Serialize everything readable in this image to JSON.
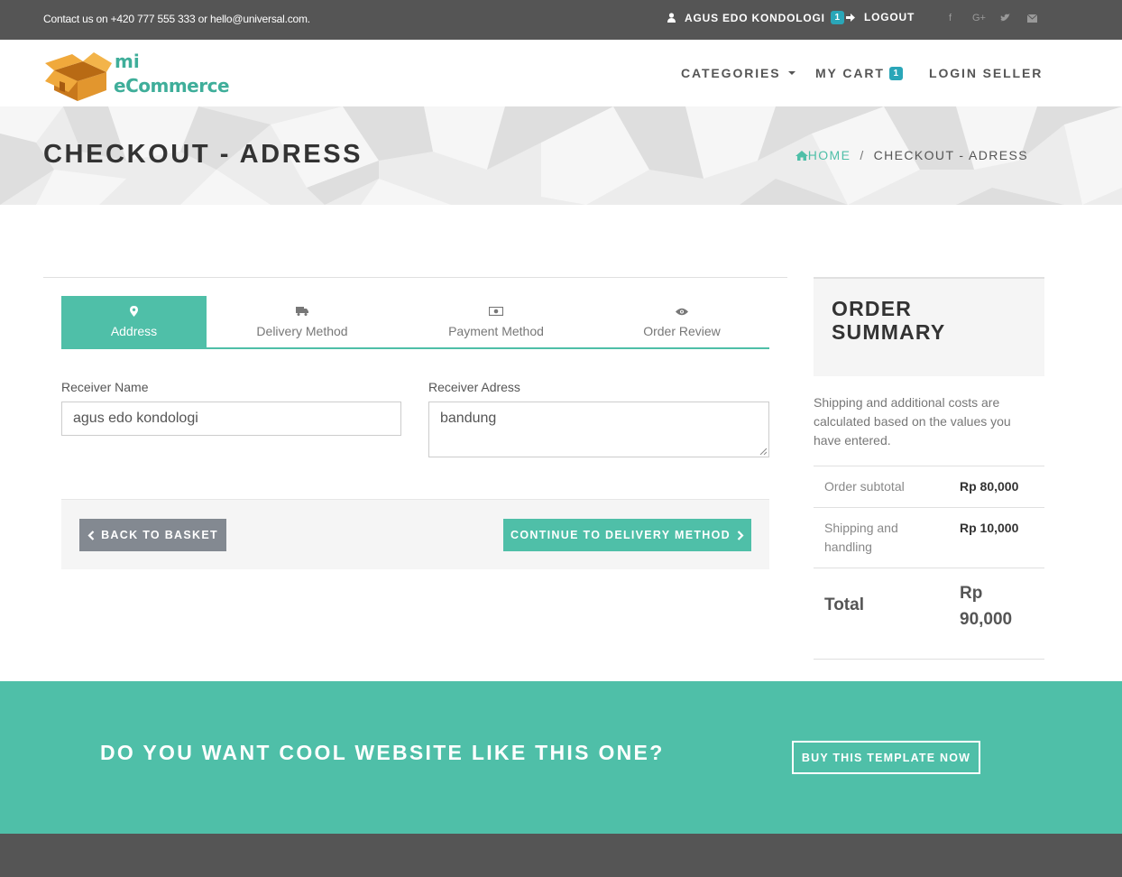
{
  "topbar": {
    "contact": "Contact us on +420 777 555 333 or hello@universal.com.",
    "user_name": "AGUS EDO KONDOLOGI",
    "user_badge": "1",
    "logout": "LOGOUT",
    "social_icons": [
      "facebook-icon",
      "google-plus-icon",
      "twitter-icon",
      "envelope-icon"
    ]
  },
  "logo": {
    "line1": "mi",
    "line2": "eCommerce"
  },
  "nav": {
    "categories": "CATEGORIES",
    "cart": "MY CART",
    "cart_badge": "1",
    "login_seller": "LOGIN SELLER"
  },
  "heading": {
    "title": "CHECKOUT - ADRESS",
    "breadcrumb_home": "HOME",
    "breadcrumb_separator": "/",
    "breadcrumb_current": "CHECKOUT - ADRESS"
  },
  "steps": [
    {
      "label": "Address",
      "icon": "map-marker-icon",
      "active": true
    },
    {
      "label": "Delivery Method",
      "icon": "truck-icon",
      "active": false
    },
    {
      "label": "Payment Method",
      "icon": "money-icon",
      "active": false
    },
    {
      "label": "Order Review",
      "icon": "eye-icon",
      "active": false
    }
  ],
  "form": {
    "receiver_name_label": "Receiver Name",
    "receiver_name_value": "agus edo kondologi",
    "receiver_address_label": "Receiver Adress",
    "receiver_address_value": "bandung"
  },
  "buttons": {
    "back": "BACK TO BASKET",
    "next": "CONTINUE TO DELIVERY METHOD"
  },
  "summary": {
    "title": "ORDER SUMMARY",
    "note": "Shipping and additional costs are calculated based on the values you have entered.",
    "rows": [
      {
        "label": "Order subtotal",
        "value": "Rp 80,000"
      },
      {
        "label": "Shipping and handling",
        "value": "Rp 10,000"
      }
    ],
    "total_label": "Total",
    "total_value": "Rp 90,000"
  },
  "cta": {
    "headline": "DO YOU WANT COOL WEBSITE LIKE THIS ONE?",
    "button": "BUY THIS TEMPLATE NOW"
  },
  "colors": {
    "accent": "#4fbfa8",
    "badge": "#2aa6b8",
    "topbar": "#555555",
    "back_button": "#838991"
  }
}
